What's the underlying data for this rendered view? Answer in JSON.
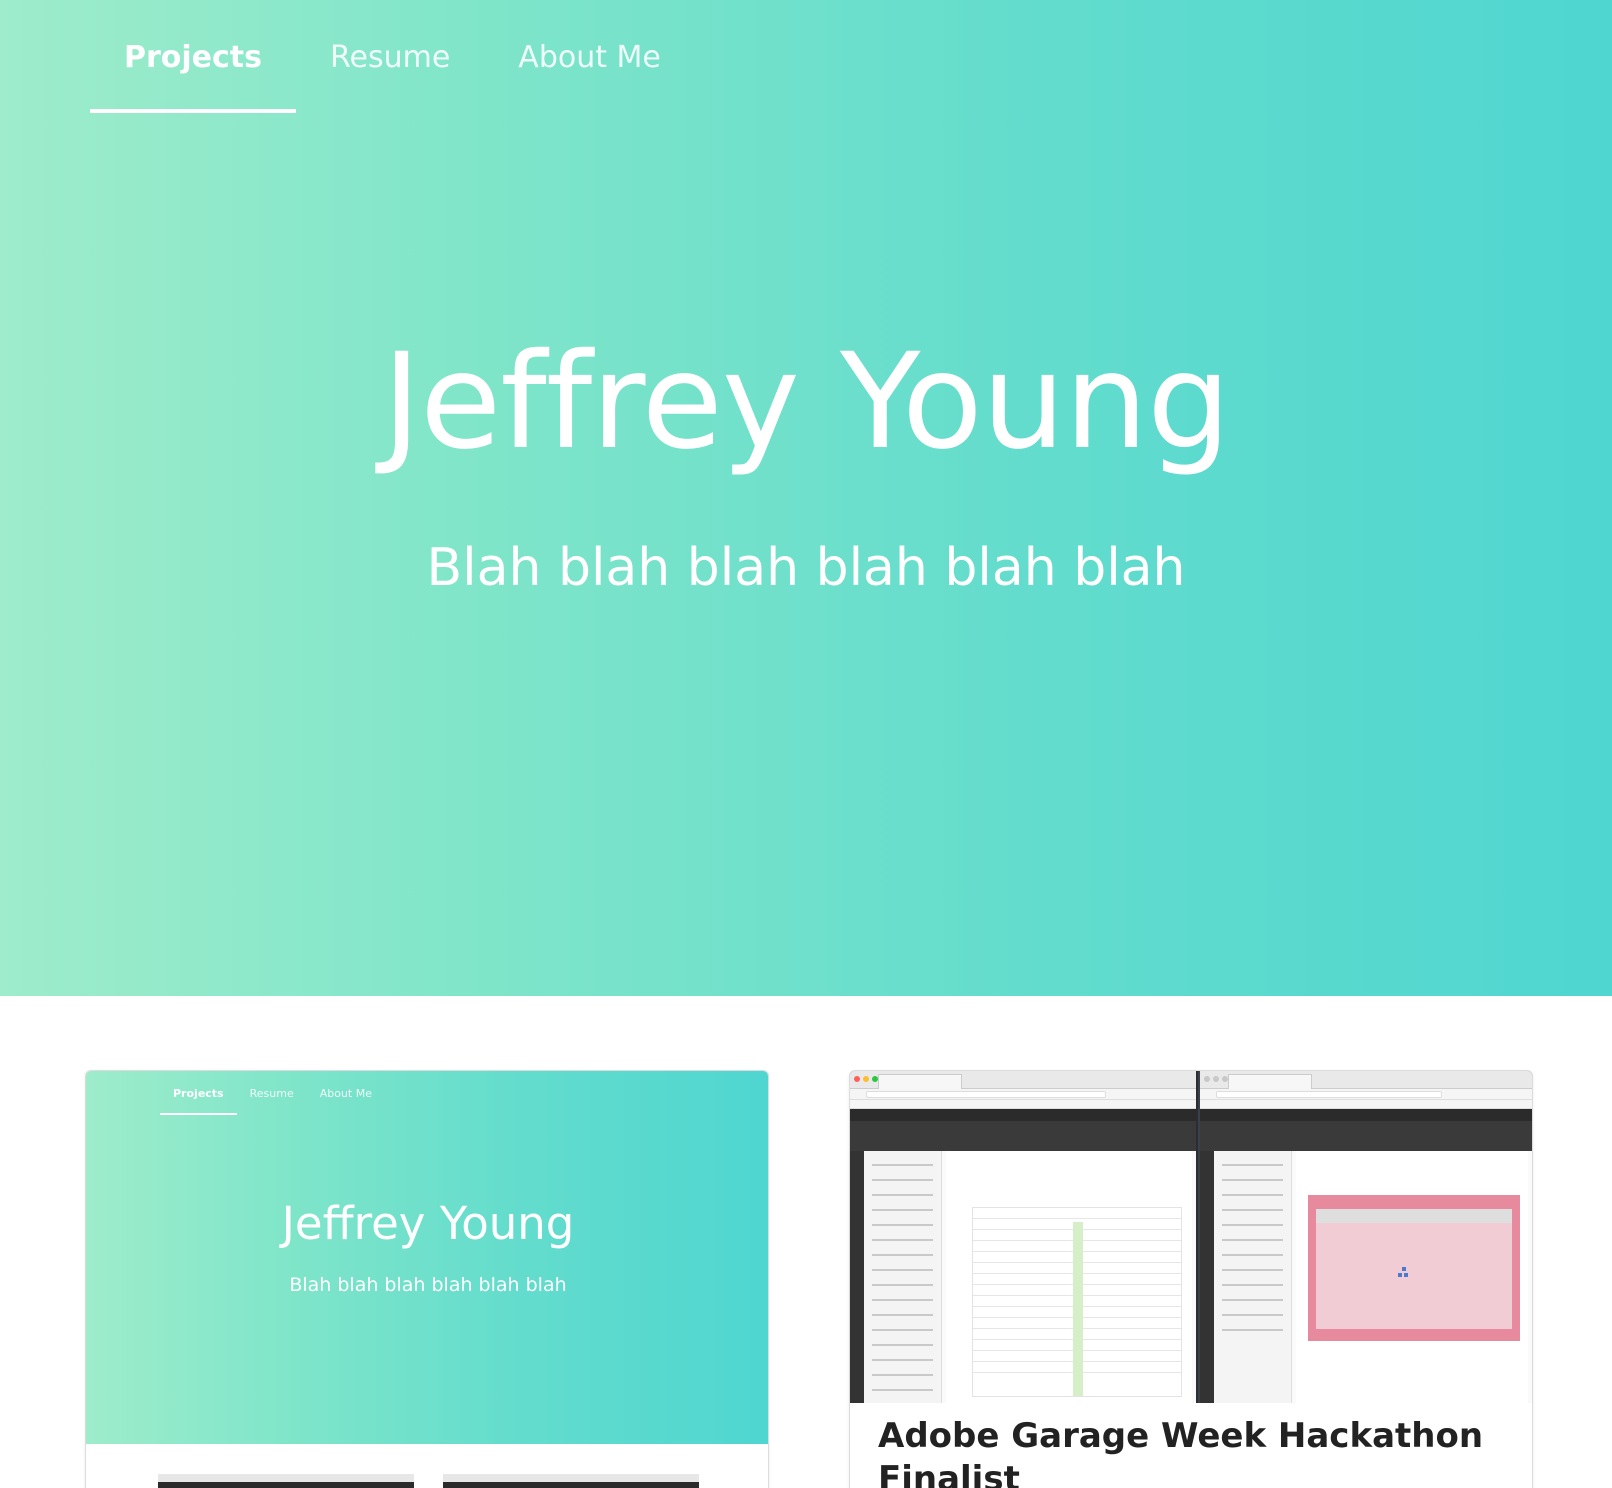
{
  "nav": {
    "tabs": [
      {
        "label": "Projects",
        "active": true
      },
      {
        "label": "Resume",
        "active": false
      },
      {
        "label": "About Me",
        "active": false
      }
    ]
  },
  "hero": {
    "title": "Jeffrey Young",
    "subtitle": "Blah blah blah blah blah blah"
  },
  "colors": {
    "gradient_start": "#9eeccb",
    "gradient_end": "#4fd6d0",
    "card_title": "#222222"
  },
  "projects": [
    {
      "preview": {
        "nav": [
          "Projects",
          "Resume",
          "About Me"
        ],
        "title": "Jeffrey Young",
        "subtitle": "Blah blah blah blah blah blah"
      }
    },
    {
      "title": "Adobe Garage Week Hackathon Finalist"
    }
  ]
}
